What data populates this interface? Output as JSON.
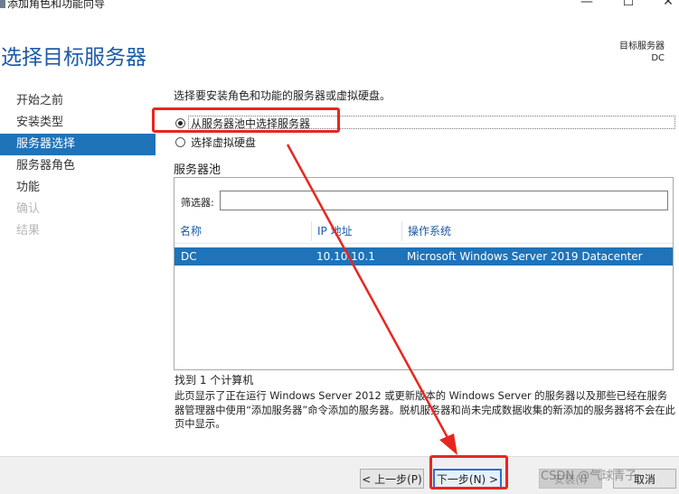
{
  "window": {
    "title": "添加角色和功能向导",
    "minimize_glyph": "—",
    "maximize_glyph": "☐",
    "close_glyph": "✕"
  },
  "page": {
    "title": "选择目标服务器",
    "target_label": "目标服务器",
    "target_value": "DC"
  },
  "nav": {
    "items": [
      {
        "label": "开始之前",
        "state": "normal"
      },
      {
        "label": "安装类型",
        "state": "normal"
      },
      {
        "label": "服务器选择",
        "state": "active"
      },
      {
        "label": "服务器角色",
        "state": "normal"
      },
      {
        "label": "功能",
        "state": "normal"
      },
      {
        "label": "确认",
        "state": "disabled"
      },
      {
        "label": "结果",
        "state": "disabled"
      }
    ]
  },
  "content": {
    "intro": "选择要安装角色和功能的服务器或虚拟硬盘。",
    "option_pool": "从服务器池中选择服务器",
    "option_vhd": "选择虚拟硬盘",
    "pool_label": "服务器池",
    "filter_label": "筛选器:",
    "filter_value": "",
    "columns": {
      "name": "名称",
      "ip": "IP 地址",
      "os": "操作系统"
    },
    "rows": [
      {
        "name": "DC",
        "ip": "10.10.10.1",
        "os": "Microsoft Windows Server 2019 Datacenter"
      }
    ],
    "found": "找到 1 个计算机",
    "description": "此页显示了正在运行 Windows Server 2012 或更新版本的 Windows Server 的服务器以及那些已经在服务器管理器中使用“添加服务器”命令添加的服务器。脱机服务器和尚未完成数据收集的新添加的服务器将不会在此页中显示。"
  },
  "footer": {
    "prev": "< 上一步(P)",
    "next": "下一步(N) >",
    "install": "安装(I)",
    "cancel": "取消"
  },
  "watermark": "CSDN @气球青子",
  "colors": {
    "accent": "#1f73b8",
    "title": "#1a5aa6",
    "annotation": "#e8261f"
  }
}
